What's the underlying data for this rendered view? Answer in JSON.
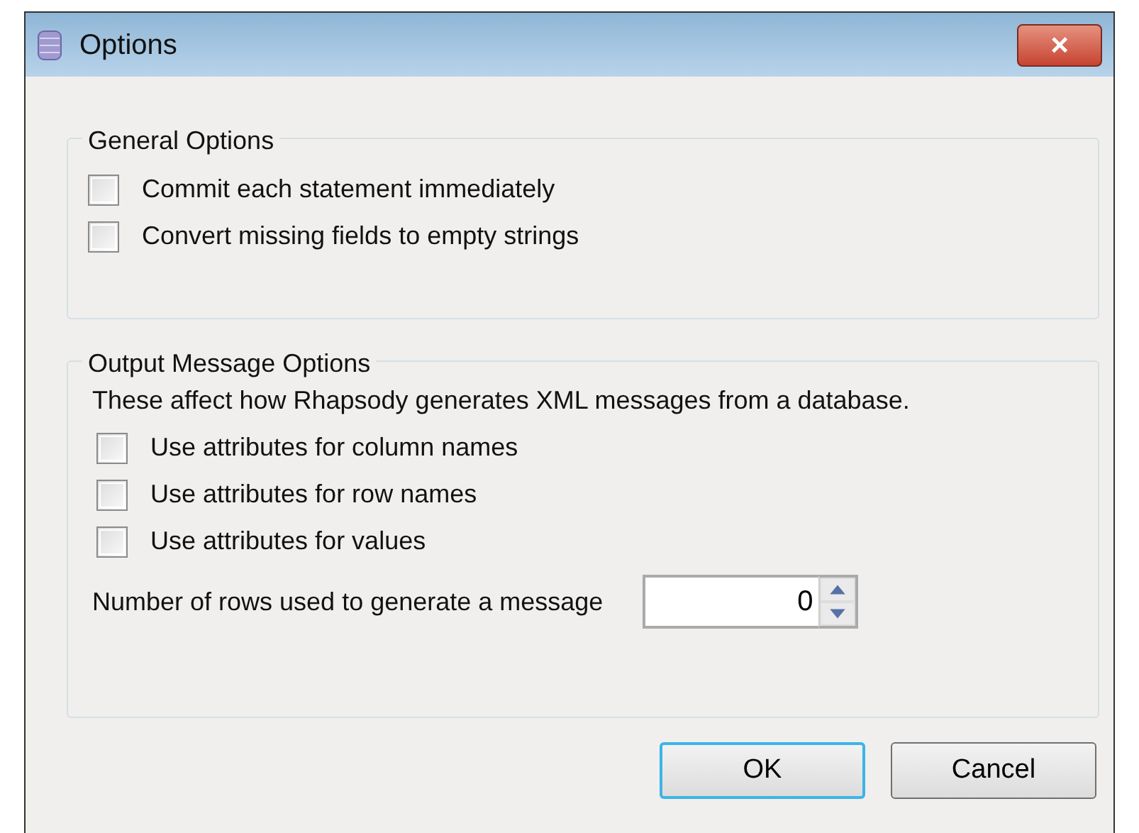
{
  "window": {
    "title": "Options",
    "close": "×"
  },
  "general_options": {
    "title": "General Options",
    "options": [
      {
        "label": "Commit each statement immediately",
        "checked": false
      },
      {
        "label": "Convert missing fields to empty strings",
        "checked": false
      }
    ]
  },
  "output_message_options": {
    "title": "Output Message Options",
    "description": "These affect how Rhapsody generates XML messages from a database.",
    "options": [
      {
        "label": "Use attributes for column names",
        "checked": false
      },
      {
        "label": "Use attributes for row names",
        "checked": false
      },
      {
        "label": "Use attributes for values",
        "checked": false
      }
    ],
    "rows_field": {
      "label": "Number of rows used to generate a message",
      "value": "0"
    }
  },
  "buttons": [
    {
      "label": "OK",
      "default": true
    },
    {
      "label": "Cancel",
      "default": false
    }
  ]
}
